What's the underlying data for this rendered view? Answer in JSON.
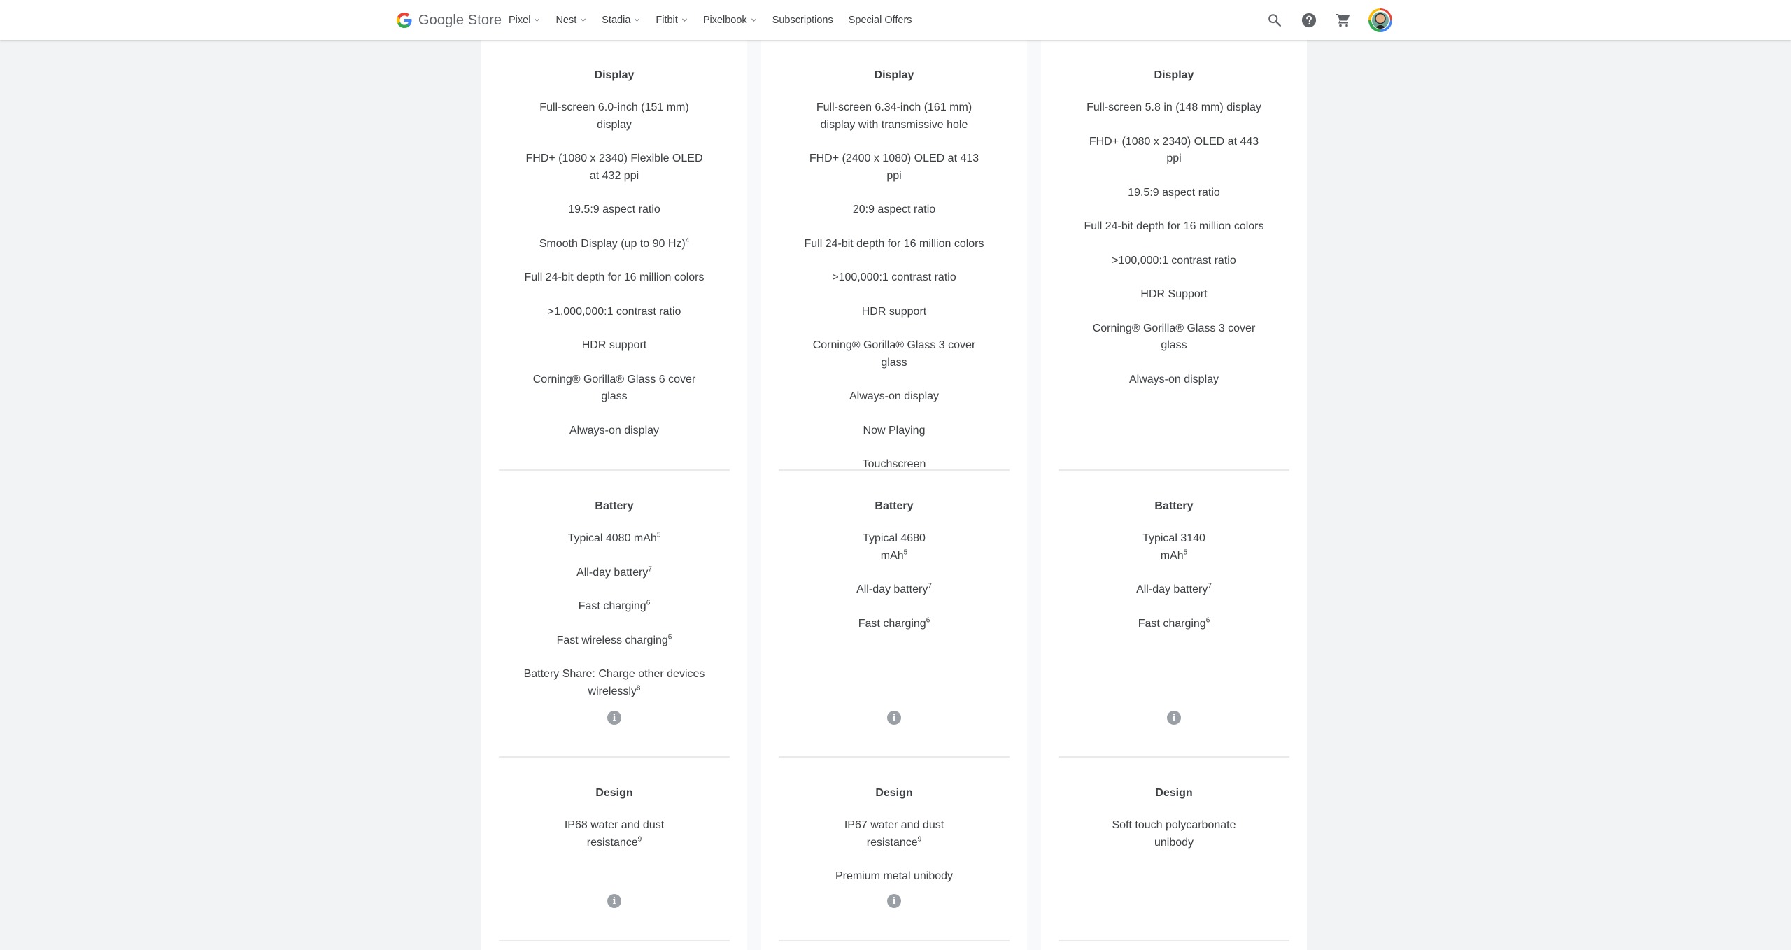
{
  "header": {
    "brand": "Google Store",
    "nav": [
      {
        "label": "Pixel",
        "has_dropdown": true
      },
      {
        "label": "Nest",
        "has_dropdown": true
      },
      {
        "label": "Stadia",
        "has_dropdown": true
      },
      {
        "label": "Fitbit",
        "has_dropdown": true
      },
      {
        "label": "Pixelbook",
        "has_dropdown": true
      },
      {
        "label": "Subscriptions",
        "has_dropdown": false
      },
      {
        "label": "Special Offers",
        "has_dropdown": false
      }
    ],
    "icons": [
      "search-icon",
      "help-icon",
      "cart-icon",
      "account-avatar"
    ]
  },
  "colors": {
    "text": "#3c4043",
    "muted": "#5f6368",
    "info_icon": "#9aa0a6",
    "page_bg": "#f1f3f4",
    "google_blue": "#4285f4",
    "google_red": "#ea4335",
    "google_yellow": "#fbbc05",
    "google_green": "#34a853"
  },
  "columns": [
    {
      "display": {
        "title": "Display",
        "specs": [
          {
            "text": "Full-screen 6.0-inch (151 mm) display",
            "sup": ""
          },
          {
            "text": "FHD+ (1080 x 2340) Flexible OLED at 432 ppi",
            "sup": ""
          },
          {
            "text": "19.5:9 aspect ratio",
            "sup": ""
          },
          {
            "text": "Smooth Display (up to 90 Hz)",
            "sup": "4"
          },
          {
            "text": "Full 24-bit depth for 16 million colors",
            "sup": ""
          },
          {
            "text": ">1,000,000:1 contrast ratio",
            "sup": ""
          },
          {
            "text": "HDR support",
            "sup": ""
          },
          {
            "text": "Corning® Gorilla® Glass 6 cover glass",
            "sup": ""
          },
          {
            "text": "Always-on display",
            "sup": ""
          }
        ]
      },
      "battery": {
        "title": "Battery",
        "specs": [
          {
            "text": "Typical 4080 mAh",
            "sup": "5"
          },
          {
            "text": "All-day battery",
            "sup": "7"
          },
          {
            "text": "Fast charging",
            "sup": "6"
          },
          {
            "text": "Fast wireless charging",
            "sup": "6"
          },
          {
            "text": "Battery Share: Charge other devices wirelessly",
            "sup": "8"
          }
        ],
        "has_info": true
      },
      "design": {
        "title": "Design",
        "specs": [
          {
            "text": "IP68 water and dust resistance",
            "sup": "9"
          }
        ],
        "has_info": true
      }
    },
    {
      "display": {
        "title": "Display",
        "specs": [
          {
            "text": "Full-screen 6.34-inch (161 mm) display with transmissive hole",
            "sup": ""
          },
          {
            "text": "FHD+ (2400 x 1080) OLED at 413 ppi",
            "sup": ""
          },
          {
            "text": "20:9 aspect ratio",
            "sup": ""
          },
          {
            "text": "Full 24-bit depth for 16 million colors",
            "sup": ""
          },
          {
            "text": ">100,000:1 contrast ratio",
            "sup": ""
          },
          {
            "text": "HDR support",
            "sup": ""
          },
          {
            "text": "Corning® Gorilla® Glass 3 cover glass",
            "sup": ""
          },
          {
            "text": "Always-on display",
            "sup": ""
          },
          {
            "text": "Now Playing",
            "sup": ""
          },
          {
            "text": "Touchscreen",
            "sup": ""
          }
        ]
      },
      "battery": {
        "title": "Battery",
        "specs": [
          {
            "text": "Typical 4680 mAh",
            "sup": "5"
          },
          {
            "text": "All-day battery",
            "sup": "7"
          },
          {
            "text": "Fast charging",
            "sup": "6"
          }
        ],
        "has_info": true
      },
      "design": {
        "title": "Design",
        "specs": [
          {
            "text": "IP67 water and dust resistance",
            "sup": "9"
          },
          {
            "text": "Premium metal unibody",
            "sup": ""
          }
        ],
        "has_info": true
      }
    },
    {
      "display": {
        "title": "Display",
        "specs": [
          {
            "text": "Full-screen 5.8 in (148 mm) display",
            "sup": ""
          },
          {
            "text": "FHD+ (1080 x 2340) OLED at 443 ppi",
            "sup": ""
          },
          {
            "text": "19.5:9 aspect ratio",
            "sup": ""
          },
          {
            "text": "Full 24-bit depth for 16 million colors",
            "sup": ""
          },
          {
            "text": ">100,000:1 contrast ratio",
            "sup": ""
          },
          {
            "text": "HDR Support",
            "sup": ""
          },
          {
            "text": "Corning® Gorilla® Glass 3 cover glass",
            "sup": ""
          },
          {
            "text": "Always-on display",
            "sup": ""
          }
        ]
      },
      "battery": {
        "title": "Battery",
        "specs": [
          {
            "text": "Typical 3140 mAh",
            "sup": "5"
          },
          {
            "text": "All-day battery",
            "sup": "7"
          },
          {
            "text": "Fast charging",
            "sup": "6"
          }
        ],
        "has_info": true
      },
      "design": {
        "title": "Design",
        "specs": [
          {
            "text": "Soft touch polycarbonate unibody",
            "sup": ""
          }
        ],
        "has_info": false
      }
    }
  ]
}
